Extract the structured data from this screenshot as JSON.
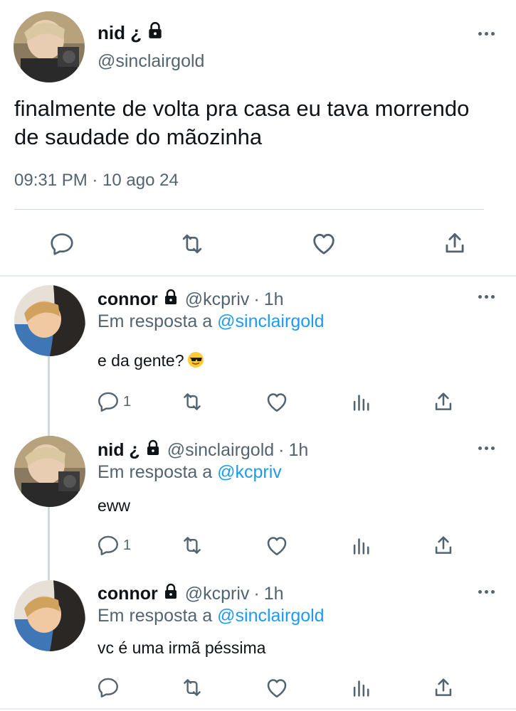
{
  "main_tweet": {
    "name": "nid ¿",
    "handle": "@sinclairgold",
    "text": "finalmente de volta pra casa eu tava morrendo de saudade do mãozinha",
    "timestamp": "09:31 PM · 10 ago 24",
    "actions": [
      "reply-icon",
      "retweet-icon",
      "like-icon",
      "share-icon"
    ]
  },
  "replies": [
    {
      "name": "connor",
      "handle": "@kcpriv",
      "time": "1h",
      "reply_prefix": "Em resposta a ",
      "reply_mention": "@sinclairgold",
      "text": "e da gente?",
      "emoji": "sunglasses-emoji",
      "reply_count": "1"
    },
    {
      "name": "nid ¿",
      "handle": "@sinclairgold",
      "time": "1h",
      "reply_prefix": "Em resposta a ",
      "reply_mention": "@kcpriv",
      "text": "eww",
      "reply_count": "1"
    },
    {
      "name": "connor",
      "handle": "@kcpriv",
      "time": "1h",
      "reply_prefix": "Em resposta a ",
      "reply_mention": "@sinclairgold",
      "text": "vc é uma irmã péssima",
      "reply_count": ""
    }
  ],
  "dot_separator": "·",
  "colors": {
    "accent": "#1d9bf0",
    "secondary_text": "#536471",
    "divider": "#cfd9de"
  }
}
